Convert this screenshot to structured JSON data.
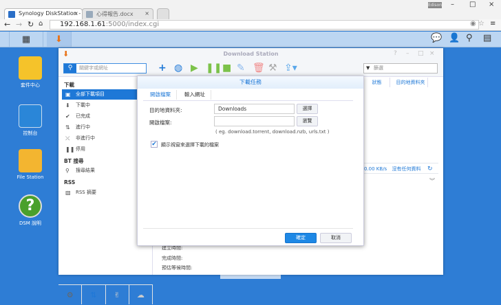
{
  "browser": {
    "tabs": [
      {
        "label": "Synology DiskStation - D",
        "active": true
      },
      {
        "label": "心得報告.docx",
        "active": false
      }
    ],
    "user": "Edison",
    "url_host": "192.168.1.61",
    "url_rest": ":5000/index.cgi"
  },
  "desktop": {
    "icons": [
      {
        "label": "套件中心"
      },
      {
        "label": "控制台"
      },
      {
        "label": "File Station"
      },
      {
        "label": "DSM 說明"
      }
    ]
  },
  "window": {
    "title": "Download Station",
    "search_placeholder": "關鍵字或網址",
    "filter_placeholder": "篩選",
    "sidebar": {
      "sections": [
        {
          "title": "下載",
          "items": [
            "全部下載項目",
            "下載中",
            "已完成",
            "進行中",
            "非進行中",
            "停用"
          ]
        },
        {
          "title": "BT 搜尋",
          "items": [
            "搜尋結果"
          ]
        },
        {
          "title": "RSS",
          "items": [
            "RSS 摘要"
          ]
        }
      ],
      "selected": "全部下載項目"
    },
    "columns": [
      "狀態",
      "目的地資料夾"
    ],
    "status": {
      "speed": "0.00 KB/s",
      "empty": "沒有任何資料"
    },
    "details": [
      "建立時間:",
      "完成時間:",
      "預估等候時間:"
    ]
  },
  "dialog": {
    "title": "下載任務",
    "tabs": [
      "開啟檔案",
      "輸入網址"
    ],
    "active_tab": "開啟檔案",
    "dest_label": "目的地資料夾:",
    "dest_value": "Downloads",
    "dest_button": "選擇",
    "file_label": "開啟檔案:",
    "file_value": "",
    "file_button": "瀏覽",
    "hint": "( eg. download.torrent, download.nzb, urls.txt )",
    "checkbox_label": "顯示視窗來選擇下載的檔案",
    "checkbox_checked": true,
    "ok": "確定",
    "cancel": "取消"
  }
}
